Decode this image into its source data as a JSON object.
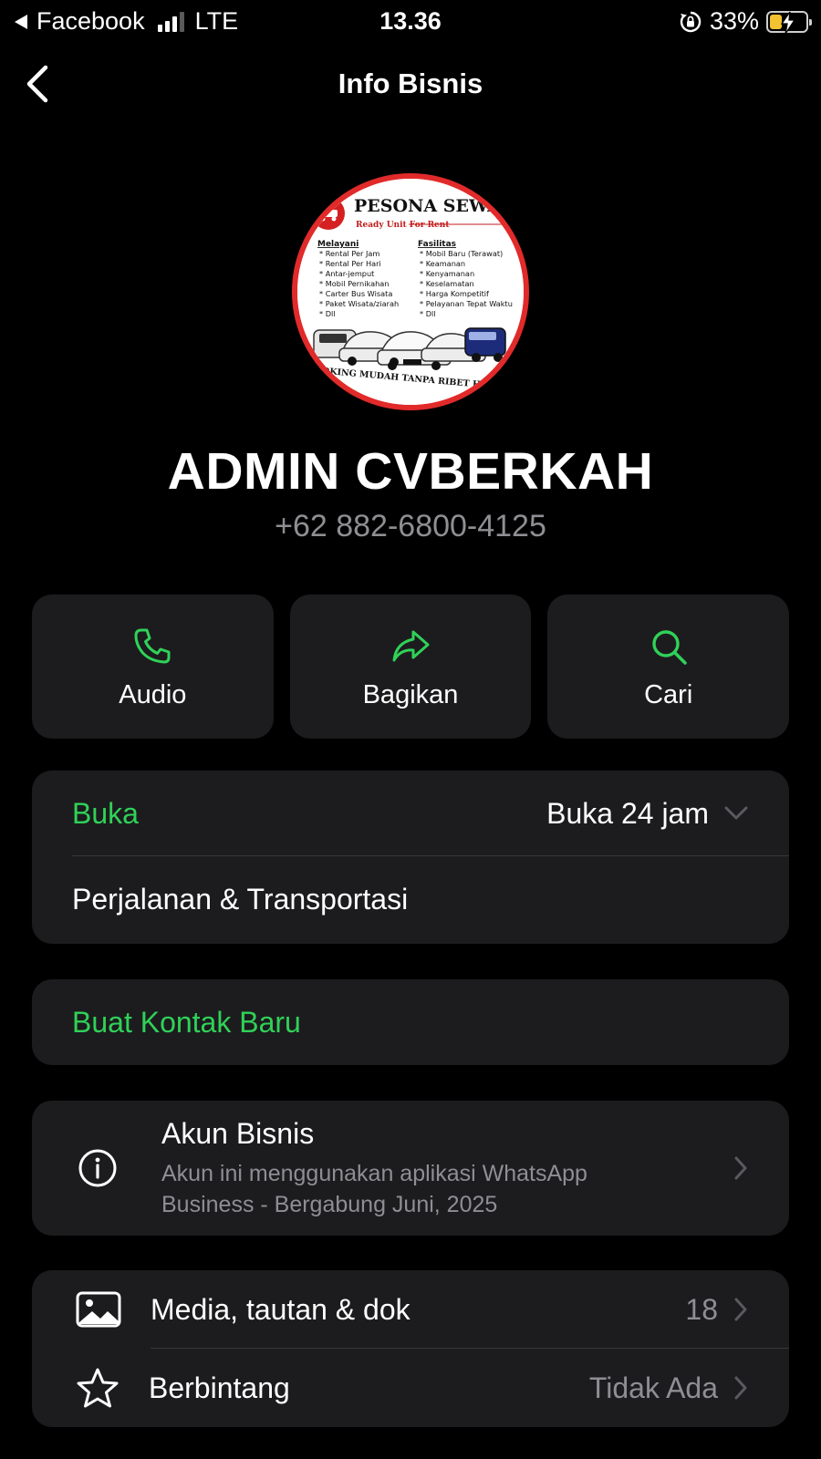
{
  "status_bar": {
    "back_app": "Facebook",
    "network": "LTE",
    "time": "13.36",
    "battery_percent": "33%",
    "battery_level": 0.33
  },
  "nav": {
    "title": "Info Bisnis"
  },
  "profile": {
    "name": "ADMIN CVBERKAH",
    "phone": "+62 882-6800-4125",
    "avatar": {
      "brand": "PESONA SEWA MOBIL",
      "tagline": "Ready Unit For Rent",
      "col1_title": "Melayani",
      "col1_items": [
        "* Rental Per Jam",
        "* Rental Per Hari",
        "* Antar-jemput",
        "* Mobil Pernikahan",
        "* Carter Bus Wisata",
        "* Paket Wisata/ziarah",
        "* Dll"
      ],
      "col2_title": "Fasilitas",
      "col2_items": [
        "* Mobil Baru (Terawat)",
        "* Keamanan",
        "* Kenyamanan",
        "* Keselamatan",
        "* Harga Kompetitif",
        "* Pelayanan Tepat Waktu",
        "* Dll"
      ],
      "bottom_text": "BOOKING MUDAH TANPA RIBET HARGA MURAH"
    }
  },
  "actions": [
    {
      "label": "Audio",
      "icon": "phone-icon"
    },
    {
      "label": "Bagikan",
      "icon": "share-icon"
    },
    {
      "label": "Cari",
      "icon": "search-icon"
    }
  ],
  "hours": {
    "status": "Buka",
    "value": "Buka 24 jam",
    "category": "Perjalanan & Transportasi"
  },
  "new_contact": {
    "label": "Buat Kontak Baru"
  },
  "business_account": {
    "title": "Akun Bisnis",
    "subtitle": "Akun ini menggunakan aplikasi WhatsApp Business - Bergabung Juni, 2025"
  },
  "media": {
    "label": "Media, tautan & dok",
    "count": "18"
  },
  "starred": {
    "label": "Berbintang",
    "value": "Tidak Ada"
  },
  "colors": {
    "accent": "#30d158",
    "background": "#000000",
    "card": "#1c1c1e",
    "muted": "#8e8e93"
  }
}
